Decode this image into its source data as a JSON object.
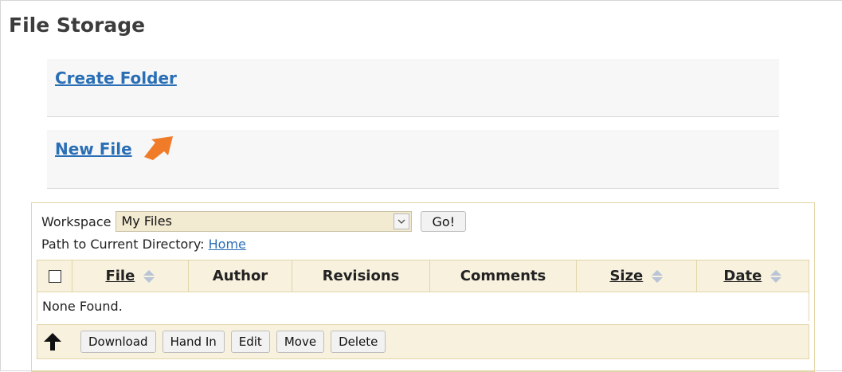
{
  "page": {
    "title": "File Storage"
  },
  "actions": {
    "create_folder": "Create Folder",
    "new_file": "New File"
  },
  "workspace": {
    "label": "Workspace",
    "selected": "My Files",
    "go_label": "Go!"
  },
  "path": {
    "label": "Path to Current Directory:",
    "home_link": "Home"
  },
  "table": {
    "columns": [
      "File",
      "Author",
      "Revisions",
      "Comments",
      "Size",
      "Date"
    ],
    "empty_message": "None Found."
  },
  "toolbar": {
    "buttons": [
      "Download",
      "Hand In",
      "Edit",
      "Move",
      "Delete"
    ]
  },
  "colors": {
    "link": "#2a6fb6",
    "arrow": "#f07b28",
    "panel_bg": "#f7f1de",
    "panel_border": "#e2d6a8"
  },
  "icons": {
    "pointer": "arrow-pointer-icon",
    "sort": "sort-updown-icon",
    "up": "up-directory-icon"
  }
}
